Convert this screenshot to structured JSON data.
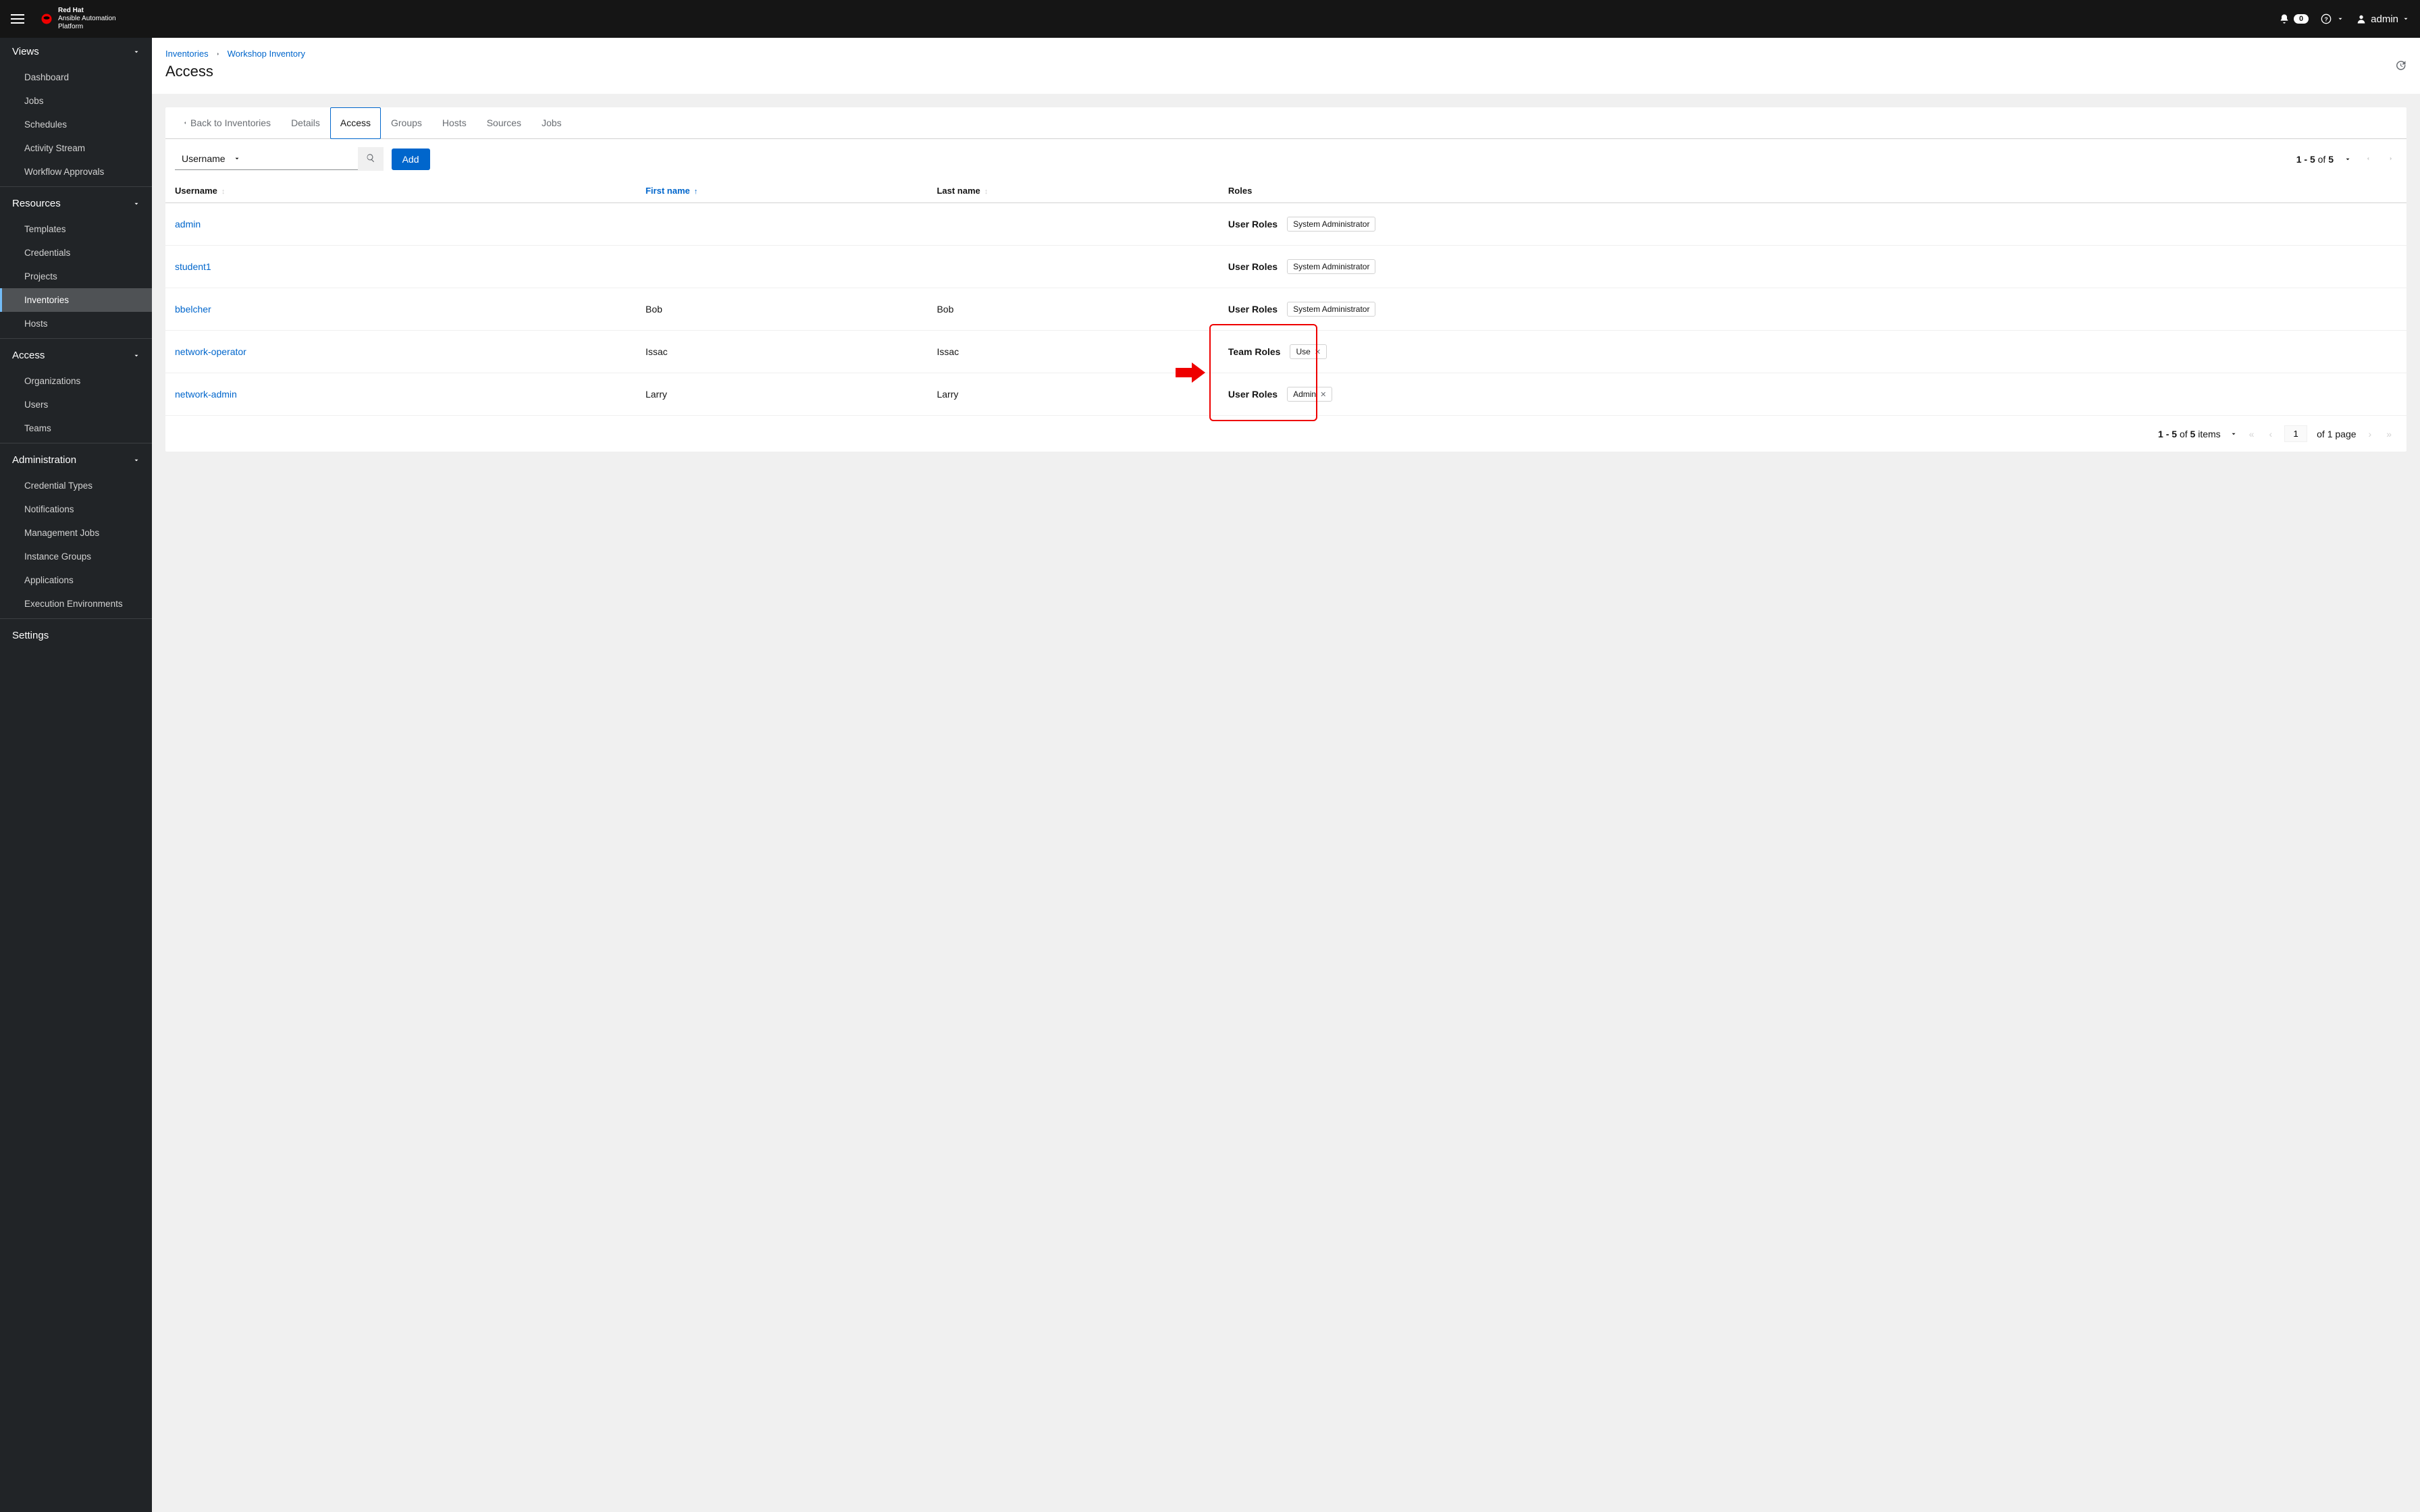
{
  "brand": {
    "line1": "Red Hat",
    "line2": "Ansible Automation",
    "line3": "Platform"
  },
  "topbar": {
    "notif_count": "0",
    "user": "admin"
  },
  "sidebar": {
    "views": {
      "title": "Views",
      "items": [
        "Dashboard",
        "Jobs",
        "Schedules",
        "Activity Stream",
        "Workflow Approvals"
      ]
    },
    "resources": {
      "title": "Resources",
      "items": [
        "Templates",
        "Credentials",
        "Projects",
        "Inventories",
        "Hosts"
      ],
      "active_index": 3
    },
    "access": {
      "title": "Access",
      "items": [
        "Organizations",
        "Users",
        "Teams"
      ]
    },
    "administration": {
      "title": "Administration",
      "items": [
        "Credential Types",
        "Notifications",
        "Management Jobs",
        "Instance Groups",
        "Applications",
        "Execution Environments"
      ]
    },
    "settings": {
      "title": "Settings"
    }
  },
  "breadcrumb": {
    "a": "Inventories",
    "b": "Workshop Inventory"
  },
  "page_title": "Access",
  "tabs": {
    "back": "Back to Inventories",
    "items": [
      "Details",
      "Access",
      "Groups",
      "Hosts",
      "Sources",
      "Jobs"
    ],
    "active_index": 1
  },
  "toolbar": {
    "filter_field": "Username",
    "search_placeholder": "",
    "add_label": "Add",
    "range_text": "1 - 5 of 5"
  },
  "columns": {
    "username": "Username",
    "first_name": "First name",
    "last_name": "Last name",
    "roles": "Roles"
  },
  "rows": [
    {
      "username": "admin",
      "first": "",
      "last": "",
      "roles": [
        {
          "group": "User Roles",
          "chips": [
            {
              "label": "System Administrator",
              "removable": false
            }
          ]
        }
      ]
    },
    {
      "username": "student1",
      "first": "",
      "last": "",
      "roles": [
        {
          "group": "User Roles",
          "chips": [
            {
              "label": "System Administrator",
              "removable": false
            }
          ]
        }
      ]
    },
    {
      "username": "bbelcher",
      "first": "Bob",
      "last": "Bob",
      "roles": [
        {
          "group": "User Roles",
          "chips": [
            {
              "label": "System Administrator",
              "removable": false
            }
          ]
        }
      ]
    },
    {
      "username": "network-operator",
      "first": "Issac",
      "last": "Issac",
      "roles": [
        {
          "group": "Team Roles",
          "chips": [
            {
              "label": "Use",
              "removable": true
            }
          ]
        }
      ]
    },
    {
      "username": "network-admin",
      "first": "Larry",
      "last": "Larry",
      "roles": [
        {
          "group": "User Roles",
          "chips": [
            {
              "label": "Admin",
              "removable": true
            }
          ]
        }
      ]
    }
  ],
  "bottom_pager": {
    "range": "1 - 5 of 5 items",
    "page": "1",
    "of_text": "of 1 page"
  }
}
